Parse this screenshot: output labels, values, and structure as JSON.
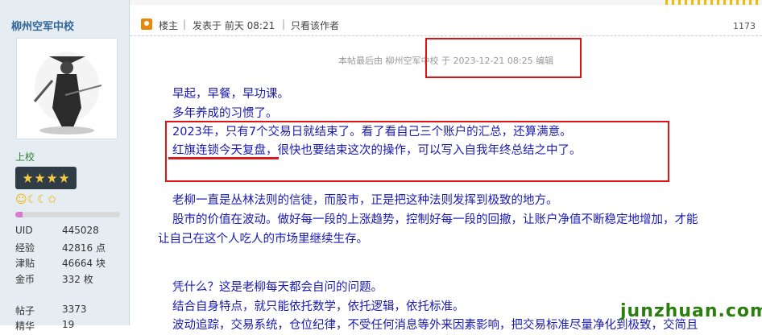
{
  "user": {
    "name": "柳州空军中校",
    "rank": "上校",
    "medals": "☺☾☾✩",
    "level_progress": 0.07,
    "stats": [
      {
        "key": "UID",
        "value": "445028"
      },
      {
        "key": "经验",
        "value": "42816 点"
      },
      {
        "key": "津贴",
        "value": "46664 块"
      },
      {
        "key": "金币",
        "value": "332 枚"
      },
      {
        "key": "",
        "value": ""
      },
      {
        "key": "帖子",
        "value": "3373"
      },
      {
        "key": "精华",
        "value": "19"
      }
    ]
  },
  "post": {
    "floor_label": "楼主",
    "posted": "发表于 前天 08:21",
    "only_author": "只看该作者",
    "views": "1173",
    "edit_note": "本帖最后由 柳州空军中校 于 2023-12-21 08:25 编辑",
    "lines": [
      "早起，早餐，早功课。",
      "多年养成的习惯了。",
      "2023年，只有7个交易日就结束了。看了看自己三个账户的汇总，还算满意。",
      "红旗连锁今天复盘，很快也要结束这次的操作，可以写入自我年终总结之中了。",
      "老柳一直是丛林法则的信徒，而股市，正是把这种法则发挥到极致的地方。",
      "股市的价值在波动。做好每一段的上涨趋势，控制好每一段的回撤，让账户净值不断稳定地增加，才能",
      "让自己在这个人吃人的市场里继续生存。",
      "凭什么？这是老柳每天都会自问的问题。",
      "结合自身特点，就只能依托数学，依托逻辑，依托标准。",
      "波动追踪，交易系统，仓位纪律，不受任何消息等外来因素影响，把交易标准尽量净化到极致，交简且"
    ]
  },
  "watermark": "junzhuan.com",
  "colors": {
    "accent_red": "#e01313",
    "text_blue": "#1a1ab3",
    "sidebar_bg": "#e5edf2"
  }
}
